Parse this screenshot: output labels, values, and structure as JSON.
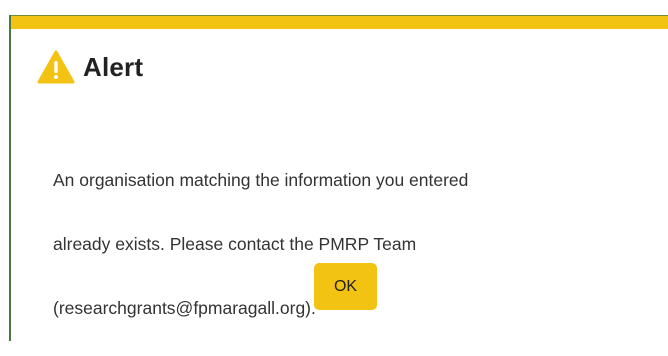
{
  "dialog": {
    "title": "Alert",
    "icon": "warning-icon",
    "message_line1": "An organisation matching the information you entered",
    "message_line2": "already exists. Please contact the PMRP Team",
    "message_line3": "(researchgrants@fpmaragall.org).",
    "ok_label": "OK"
  },
  "colors": {
    "accent": "#f3c313",
    "border": "#4a7a3a",
    "title_text": "#222222",
    "body_text": "#333333"
  }
}
